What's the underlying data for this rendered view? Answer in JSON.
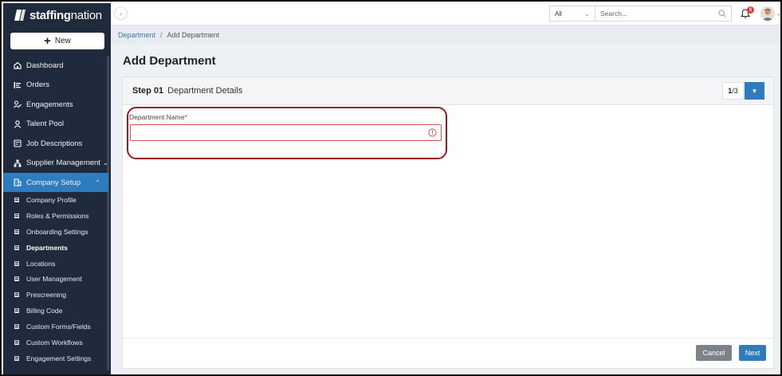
{
  "app": {
    "logo_bold": "staffing",
    "logo_light": "nation"
  },
  "sidebar": {
    "new_label": "New",
    "items": [
      {
        "label": "Dashboard",
        "icon": "dashboard-icon"
      },
      {
        "label": "Orders",
        "icon": "orders-icon"
      },
      {
        "label": "Engagements",
        "icon": "engagements-icon"
      },
      {
        "label": "Talent Pool",
        "icon": "talent-pool-icon"
      },
      {
        "label": "Job Descriptions",
        "icon": "job-descriptions-icon"
      },
      {
        "label": "Supplier Management",
        "icon": "supplier-management-icon"
      },
      {
        "label": "Company Setup",
        "icon": "company-setup-icon"
      }
    ],
    "sub_items": [
      "Company Profile",
      "Roles & Permissions",
      "Onboarding Settings",
      "Departments",
      "Locations",
      "User Management",
      "Prescreening",
      "Billing Code",
      "Custom Forms/Fields",
      "Custom Workflows",
      "Engagement Settings"
    ]
  },
  "topbar": {
    "filter_value": "All",
    "search_placeholder": "Search...",
    "notification_count": "5"
  },
  "breadcrumb": {
    "parent": "Department",
    "separator": "/",
    "current": "Add Department"
  },
  "main": {
    "title": "Add Department",
    "step": {
      "number": "Step 01",
      "title": "Department Details",
      "current": "1",
      "total": "/3"
    },
    "form": {
      "department_name_label": "Department Name",
      "required_mark": "*",
      "department_name_value": ""
    },
    "footer": {
      "cancel_label": "Cancel",
      "next_label": "Next"
    }
  },
  "colors": {
    "sidebar_bg": "#1f2a3c",
    "accent": "#2f7bbf",
    "error": "#d9534f",
    "highlight": "#9b1c1f"
  }
}
